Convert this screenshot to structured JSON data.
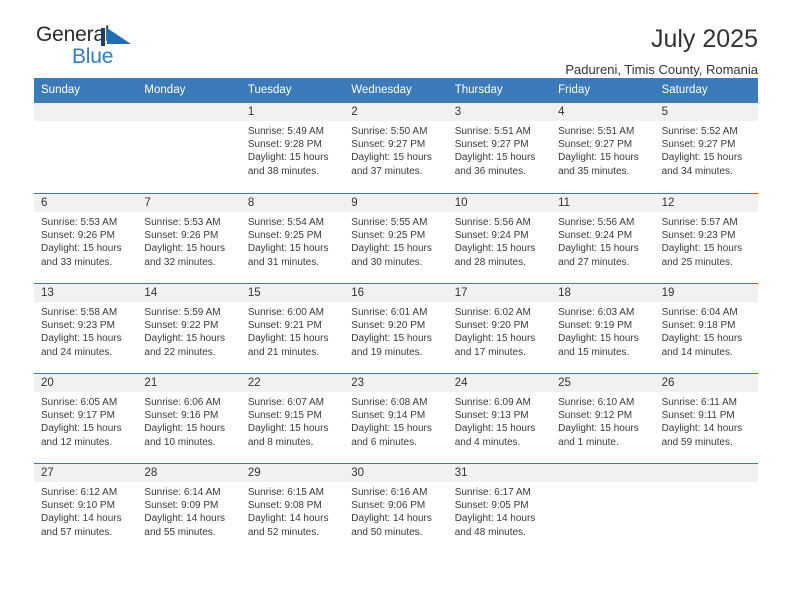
{
  "logo": {
    "word1": "General",
    "word2": "Blue",
    "flag_icon": "blue-flag-triangle-icon",
    "brand_color": "#2f7fc6",
    "dark_color": "#2b2b2b"
  },
  "header": {
    "title": "July 2025",
    "subtitle": "Padureni, Timis County, Romania"
  },
  "theme": {
    "header_blue": "#3d7ab9",
    "day_band_gray": "#f1f1f1",
    "text": "#333333"
  },
  "calendar": {
    "weekdays": [
      "Sunday",
      "Monday",
      "Tuesday",
      "Wednesday",
      "Thursday",
      "Friday",
      "Saturday"
    ],
    "labels": {
      "sunrise": "Sunrise:",
      "sunset": "Sunset:",
      "daylight": "Daylight:"
    },
    "weeks": [
      [
        {
          "day": ""
        },
        {
          "day": ""
        },
        {
          "day": "1",
          "sunrise": "Sunrise: 5:49 AM",
          "sunset": "Sunset: 9:28 PM",
          "daylight": "Daylight: 15 hours and 38 minutes."
        },
        {
          "day": "2",
          "sunrise": "Sunrise: 5:50 AM",
          "sunset": "Sunset: 9:27 PM",
          "daylight": "Daylight: 15 hours and 37 minutes."
        },
        {
          "day": "3",
          "sunrise": "Sunrise: 5:51 AM",
          "sunset": "Sunset: 9:27 PM",
          "daylight": "Daylight: 15 hours and 36 minutes."
        },
        {
          "day": "4",
          "sunrise": "Sunrise: 5:51 AM",
          "sunset": "Sunset: 9:27 PM",
          "daylight": "Daylight: 15 hours and 35 minutes."
        },
        {
          "day": "5",
          "sunrise": "Sunrise: 5:52 AM",
          "sunset": "Sunset: 9:27 PM",
          "daylight": "Daylight: 15 hours and 34 minutes."
        }
      ],
      [
        {
          "day": "6",
          "sunrise": "Sunrise: 5:53 AM",
          "sunset": "Sunset: 9:26 PM",
          "daylight": "Daylight: 15 hours and 33 minutes."
        },
        {
          "day": "7",
          "sunrise": "Sunrise: 5:53 AM",
          "sunset": "Sunset: 9:26 PM",
          "daylight": "Daylight: 15 hours and 32 minutes."
        },
        {
          "day": "8",
          "sunrise": "Sunrise: 5:54 AM",
          "sunset": "Sunset: 9:25 PM",
          "daylight": "Daylight: 15 hours and 31 minutes."
        },
        {
          "day": "9",
          "sunrise": "Sunrise: 5:55 AM",
          "sunset": "Sunset: 9:25 PM",
          "daylight": "Daylight: 15 hours and 30 minutes."
        },
        {
          "day": "10",
          "sunrise": "Sunrise: 5:56 AM",
          "sunset": "Sunset: 9:24 PM",
          "daylight": "Daylight: 15 hours and 28 minutes."
        },
        {
          "day": "11",
          "sunrise": "Sunrise: 5:56 AM",
          "sunset": "Sunset: 9:24 PM",
          "daylight": "Daylight: 15 hours and 27 minutes."
        },
        {
          "day": "12",
          "sunrise": "Sunrise: 5:57 AM",
          "sunset": "Sunset: 9:23 PM",
          "daylight": "Daylight: 15 hours and 25 minutes."
        }
      ],
      [
        {
          "day": "13",
          "sunrise": "Sunrise: 5:58 AM",
          "sunset": "Sunset: 9:23 PM",
          "daylight": "Daylight: 15 hours and 24 minutes."
        },
        {
          "day": "14",
          "sunrise": "Sunrise: 5:59 AM",
          "sunset": "Sunset: 9:22 PM",
          "daylight": "Daylight: 15 hours and 22 minutes."
        },
        {
          "day": "15",
          "sunrise": "Sunrise: 6:00 AM",
          "sunset": "Sunset: 9:21 PM",
          "daylight": "Daylight: 15 hours and 21 minutes."
        },
        {
          "day": "16",
          "sunrise": "Sunrise: 6:01 AM",
          "sunset": "Sunset: 9:20 PM",
          "daylight": "Daylight: 15 hours and 19 minutes."
        },
        {
          "day": "17",
          "sunrise": "Sunrise: 6:02 AM",
          "sunset": "Sunset: 9:20 PM",
          "daylight": "Daylight: 15 hours and 17 minutes."
        },
        {
          "day": "18",
          "sunrise": "Sunrise: 6:03 AM",
          "sunset": "Sunset: 9:19 PM",
          "daylight": "Daylight: 15 hours and 15 minutes."
        },
        {
          "day": "19",
          "sunrise": "Sunrise: 6:04 AM",
          "sunset": "Sunset: 9:18 PM",
          "daylight": "Daylight: 15 hours and 14 minutes."
        }
      ],
      [
        {
          "day": "20",
          "sunrise": "Sunrise: 6:05 AM",
          "sunset": "Sunset: 9:17 PM",
          "daylight": "Daylight: 15 hours and 12 minutes."
        },
        {
          "day": "21",
          "sunrise": "Sunrise: 6:06 AM",
          "sunset": "Sunset: 9:16 PM",
          "daylight": "Daylight: 15 hours and 10 minutes."
        },
        {
          "day": "22",
          "sunrise": "Sunrise: 6:07 AM",
          "sunset": "Sunset: 9:15 PM",
          "daylight": "Daylight: 15 hours and 8 minutes."
        },
        {
          "day": "23",
          "sunrise": "Sunrise: 6:08 AM",
          "sunset": "Sunset: 9:14 PM",
          "daylight": "Daylight: 15 hours and 6 minutes."
        },
        {
          "day": "24",
          "sunrise": "Sunrise: 6:09 AM",
          "sunset": "Sunset: 9:13 PM",
          "daylight": "Daylight: 15 hours and 4 minutes."
        },
        {
          "day": "25",
          "sunrise": "Sunrise: 6:10 AM",
          "sunset": "Sunset: 9:12 PM",
          "daylight": "Daylight: 15 hours and 1 minute."
        },
        {
          "day": "26",
          "sunrise": "Sunrise: 6:11 AM",
          "sunset": "Sunset: 9:11 PM",
          "daylight": "Daylight: 14 hours and 59 minutes."
        }
      ],
      [
        {
          "day": "27",
          "sunrise": "Sunrise: 6:12 AM",
          "sunset": "Sunset: 9:10 PM",
          "daylight": "Daylight: 14 hours and 57 minutes."
        },
        {
          "day": "28",
          "sunrise": "Sunrise: 6:14 AM",
          "sunset": "Sunset: 9:09 PM",
          "daylight": "Daylight: 14 hours and 55 minutes."
        },
        {
          "day": "29",
          "sunrise": "Sunrise: 6:15 AM",
          "sunset": "Sunset: 9:08 PM",
          "daylight": "Daylight: 14 hours and 52 minutes."
        },
        {
          "day": "30",
          "sunrise": "Sunrise: 6:16 AM",
          "sunset": "Sunset: 9:06 PM",
          "daylight": "Daylight: 14 hours and 50 minutes."
        },
        {
          "day": "31",
          "sunrise": "Sunrise: 6:17 AM",
          "sunset": "Sunset: 9:05 PM",
          "daylight": "Daylight: 14 hours and 48 minutes."
        },
        {
          "day": ""
        },
        {
          "day": ""
        }
      ]
    ]
  }
}
